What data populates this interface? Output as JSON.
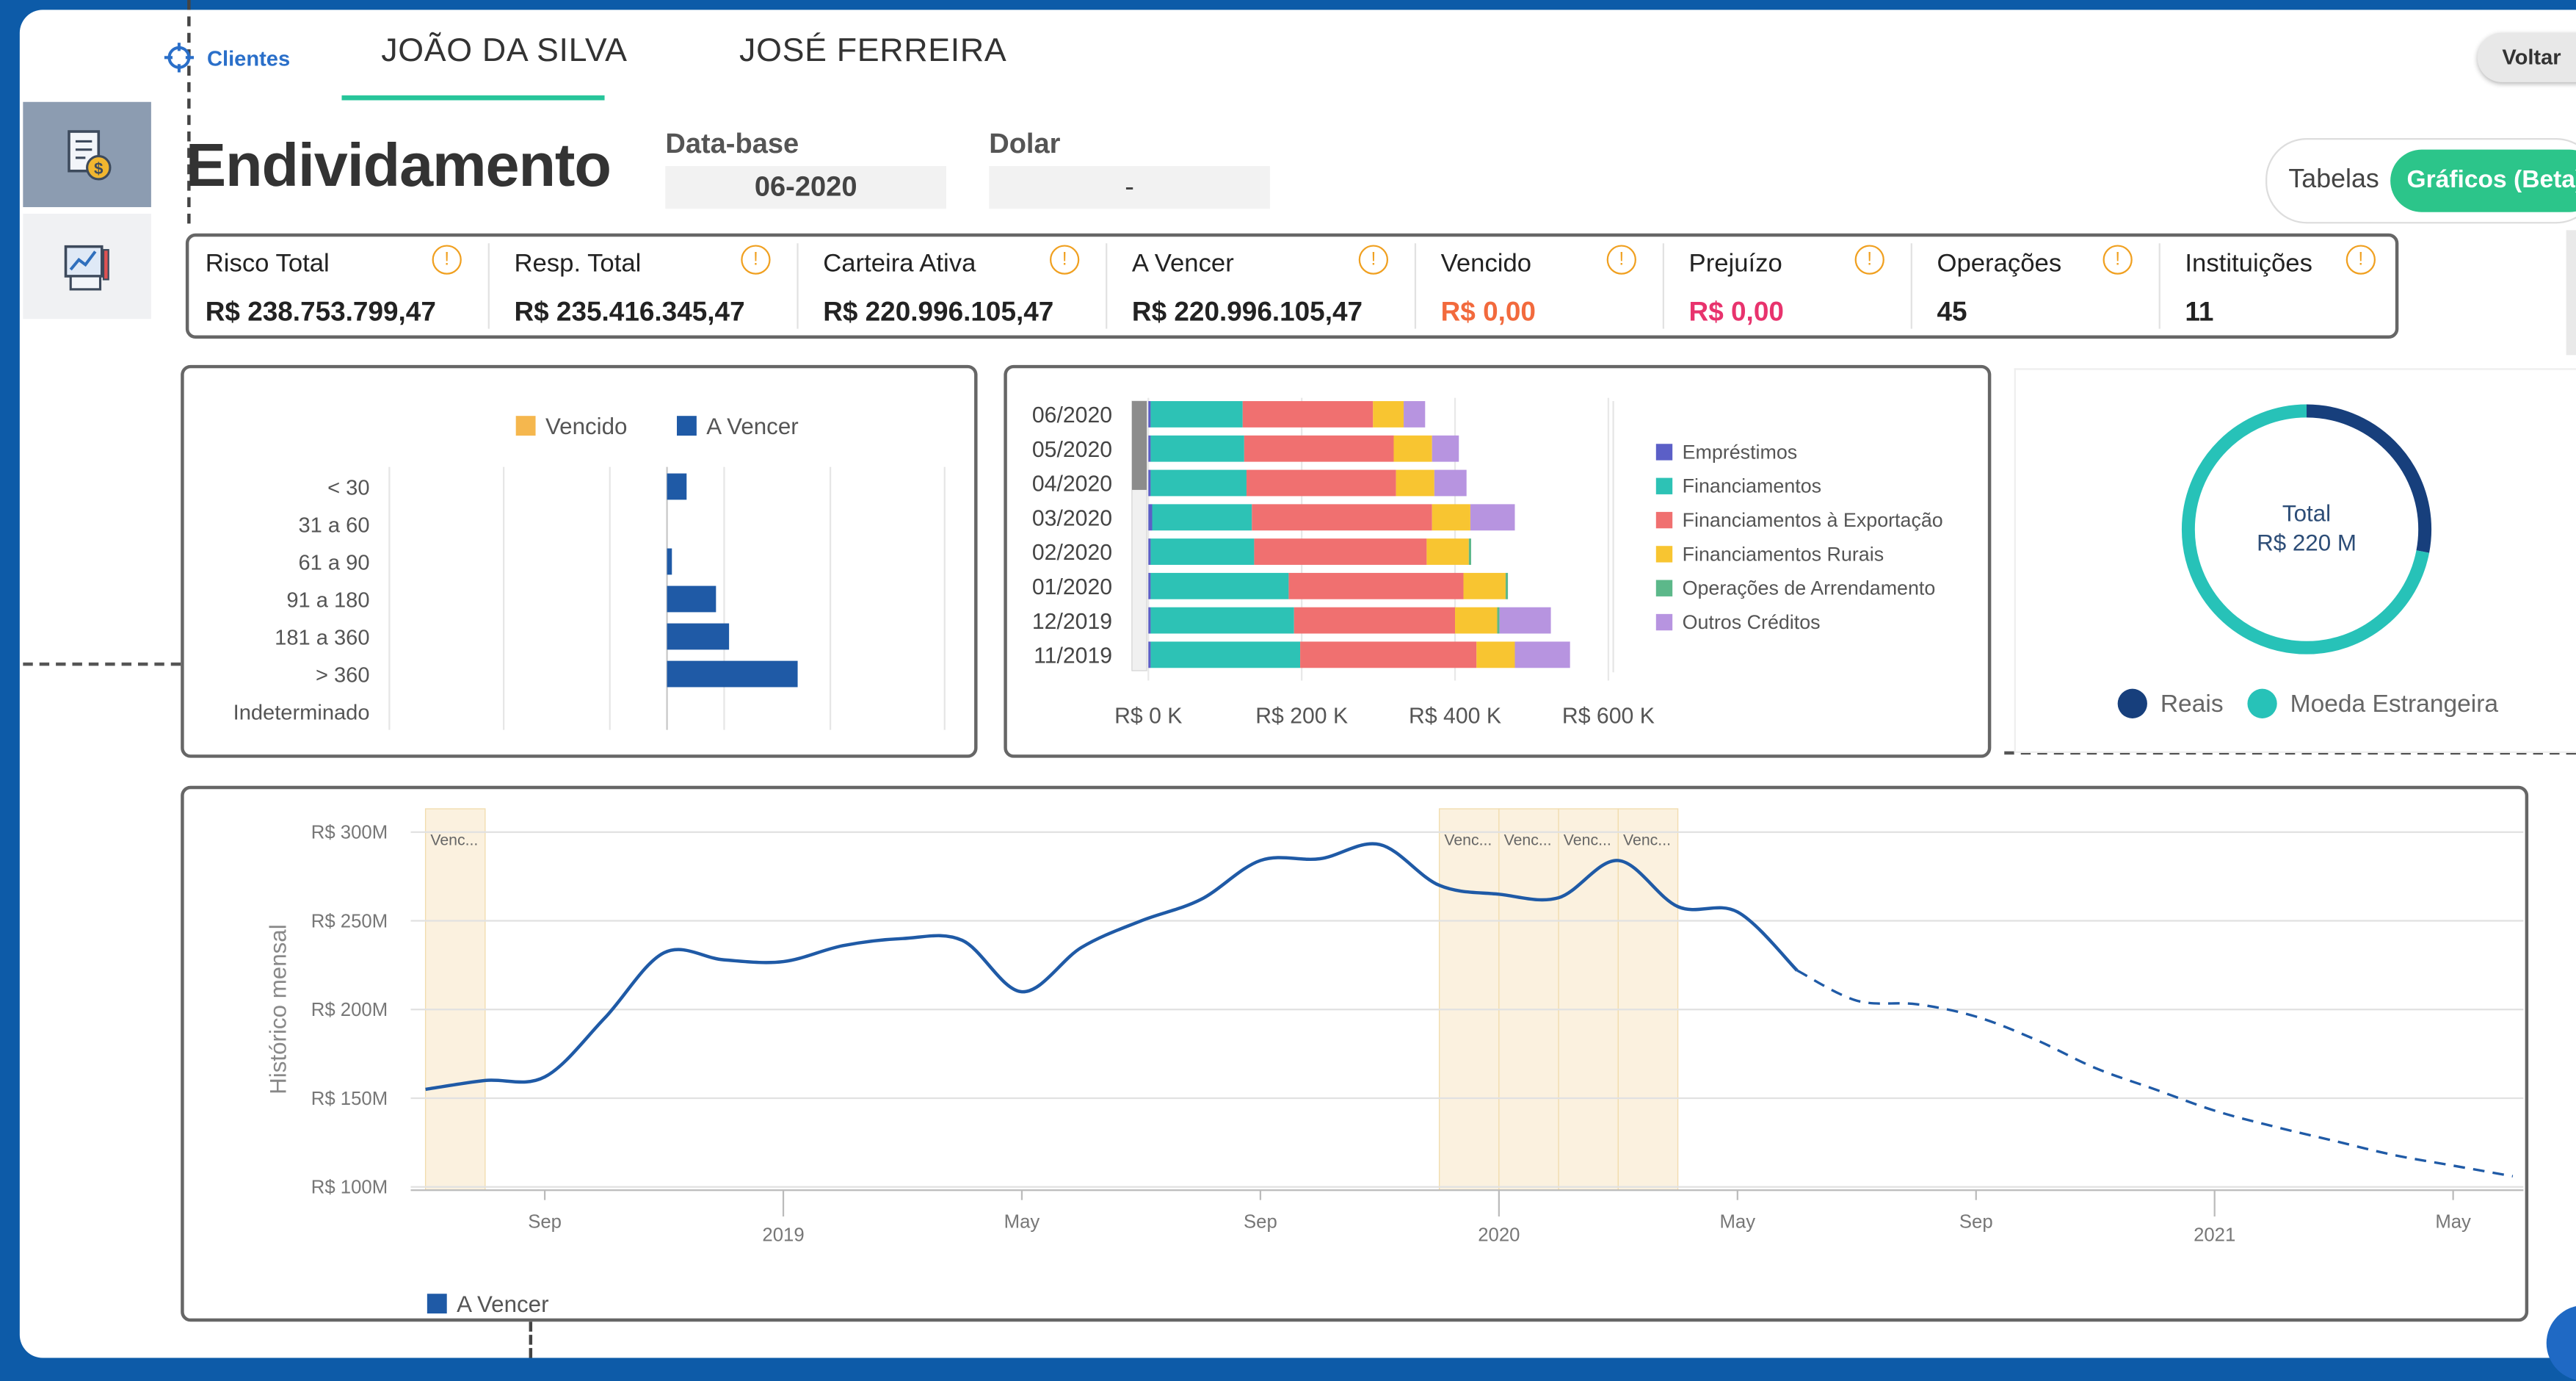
{
  "nav": {
    "clients_link": "Clientes",
    "back_button": "Voltar"
  },
  "tabs": [
    {
      "label": "JOÃO DA SILVA",
      "active": true
    },
    {
      "label": "JOSÉ FERREIRA",
      "active": false
    }
  ],
  "sidebar": [
    {
      "icon": "document-money-icon",
      "active": true
    },
    {
      "icon": "report-chart-icon",
      "active": false
    }
  ],
  "header": {
    "title": "Endividamento",
    "database_label": "Data-base",
    "database_value": "06-2020",
    "dollar_label": "Dolar",
    "dollar_value": "-",
    "toggle": {
      "tables": "Tabelas",
      "charts": "Gráficos (Beta)",
      "selected": "charts"
    }
  },
  "kpis": [
    {
      "label": "Risco Total",
      "value": "R$ 238.753.799,47",
      "color": "#222222"
    },
    {
      "label": "Resp. Total",
      "value": "R$ 235.416.345,47",
      "color": "#222222"
    },
    {
      "label": "Carteira Ativa",
      "value": "R$ 220.996.105,47",
      "color": "#222222"
    },
    {
      "label": "A Vencer",
      "value": "R$ 220.996.105,47",
      "color": "#222222"
    },
    {
      "label": "Vencido",
      "value": "R$ 0,00",
      "color": "#f26a3d"
    },
    {
      "label": "Prejuízo",
      "value": "R$ 0,00",
      "color": "#e8336d"
    },
    {
      "label": "Operações",
      "value": "45",
      "color": "#222222"
    },
    {
      "label": "Instituições",
      "value": "11",
      "color": "#222222"
    }
  ],
  "chart_data": [
    {
      "type": "bar",
      "orientation": "horizontal",
      "categories": [
        "< 30",
        "31 a 60",
        "61 a 90",
        "91 a 180",
        "181 a 360",
        "> 360",
        "Indeterminado"
      ],
      "series": [
        {
          "name": "Vencido",
          "color": "#f5b74e",
          "values": [
            0,
            0,
            0,
            0,
            0,
            0,
            0
          ]
        },
        {
          "name": "A Vencer",
          "color": "#1f5aa6",
          "values": [
            12,
            0,
            3,
            30,
            38,
            80,
            0
          ]
        }
      ],
      "xlim": [
        -170,
        170
      ],
      "grid": true,
      "legend": "top"
    },
    {
      "type": "bar",
      "orientation": "horizontal",
      "stacked": true,
      "categories": [
        "06/2020",
        "05/2020",
        "04/2020",
        "03/2020",
        "02/2020",
        "01/2020",
        "12/2019",
        "11/2019"
      ],
      "x_tick_labels": [
        "R$ 0 K",
        "R$ 200 K",
        "R$ 400 K",
        "R$ 600 K"
      ],
      "xlim": [
        0,
        600
      ],
      "series": [
        {
          "name": "Empréstimos",
          "color": "#5b5fc7",
          "values": [
            3,
            3,
            3,
            5,
            3,
            3,
            3,
            3
          ]
        },
        {
          "name": "Financiamentos",
          "color": "#2dc2b5",
          "values": [
            120,
            122,
            125,
            130,
            135,
            180,
            187,
            195
          ]
        },
        {
          "name": "Financiamentos à Exportação",
          "color": "#f07070",
          "values": [
            170,
            195,
            195,
            235,
            225,
            228,
            210,
            230
          ]
        },
        {
          "name": "Financiamentos Rurais",
          "color": "#f8c531",
          "values": [
            40,
            50,
            50,
            50,
            55,
            55,
            55,
            50
          ]
        },
        {
          "name": "Operações de Arrendamento",
          "color": "#5cb88a",
          "values": [
            0,
            0,
            0,
            0,
            3,
            3,
            3,
            0
          ]
        },
        {
          "name": "Outros Créditos",
          "color": "#b794e0",
          "values": [
            28,
            35,
            42,
            58,
            0,
            0,
            67,
            72
          ]
        }
      ],
      "legend": "right"
    },
    {
      "type": "pie",
      "donut": true,
      "center_label": "Total",
      "center_value": "R$ 220 M",
      "slices": [
        {
          "name": "Reais",
          "color": "#173f7c",
          "value": 28
        },
        {
          "name": "Moeda Estrangeira",
          "color": "#27c2b8",
          "value": 72
        }
      ],
      "legend": "bottom"
    },
    {
      "type": "line",
      "ylabel": "Histórico mensal",
      "y_tick_labels": [
        "R$ 100M",
        "R$ 150M",
        "R$ 200M",
        "R$ 250M",
        "R$ 300M"
      ],
      "ylim": [
        100,
        315
      ],
      "x_tick_labels": [
        "Sep",
        "2019",
        "May",
        "Sep",
        "2020",
        "May",
        "Sep",
        "2021",
        "May"
      ],
      "x": [
        "2018-07",
        "2018-08",
        "2018-09",
        "2018-10",
        "2018-11",
        "2018-12",
        "2019-01",
        "2019-02",
        "2019-03",
        "2019-04",
        "2019-05",
        "2019-06",
        "2019-07",
        "2019-08",
        "2019-09",
        "2019-10",
        "2019-11",
        "2019-12",
        "2020-01",
        "2020-02",
        "2020-03",
        "2020-04",
        "2020-05",
        "2020-06"
      ],
      "series": [
        {
          "name": "A Vencer",
          "color": "#1f5aa6",
          "dashed": false,
          "values": [
            155,
            160,
            162,
            195,
            232,
            228,
            227,
            236,
            240,
            239,
            210,
            235,
            250,
            262,
            284,
            285,
            293,
            270,
            265,
            263,
            284,
            258,
            255,
            222
          ]
        },
        {
          "name": "A Vencer",
          "color": "#1f5aa6",
          "dashed": true,
          "x": [
            "2020-06",
            "2020-07",
            "2020-08",
            "2020-09",
            "2020-10",
            "2020-11",
            "2020-12",
            "2021-01",
            "2021-02",
            "2021-03",
            "2021-04",
            "2021-05",
            "2021-06"
          ],
          "values": [
            222,
            205,
            203,
            196,
            183,
            167,
            155,
            143,
            134,
            126,
            118,
            112,
            106
          ]
        }
      ],
      "highlight_bands": [
        {
          "label": "Venc...",
          "from": "2018-07",
          "to": "2018-08"
        },
        {
          "label": "Venc...",
          "from": "2019-12",
          "to": "2020-01"
        },
        {
          "label": "Venc...",
          "from": "2020-01",
          "to": "2020-02"
        },
        {
          "label": "Venc...",
          "from": "2020-02",
          "to": "2020-03"
        },
        {
          "label": "Venc...",
          "from": "2020-03",
          "to": "2020-04"
        }
      ],
      "band_color": "#fbf1df",
      "legend": "bottom-left"
    }
  ]
}
